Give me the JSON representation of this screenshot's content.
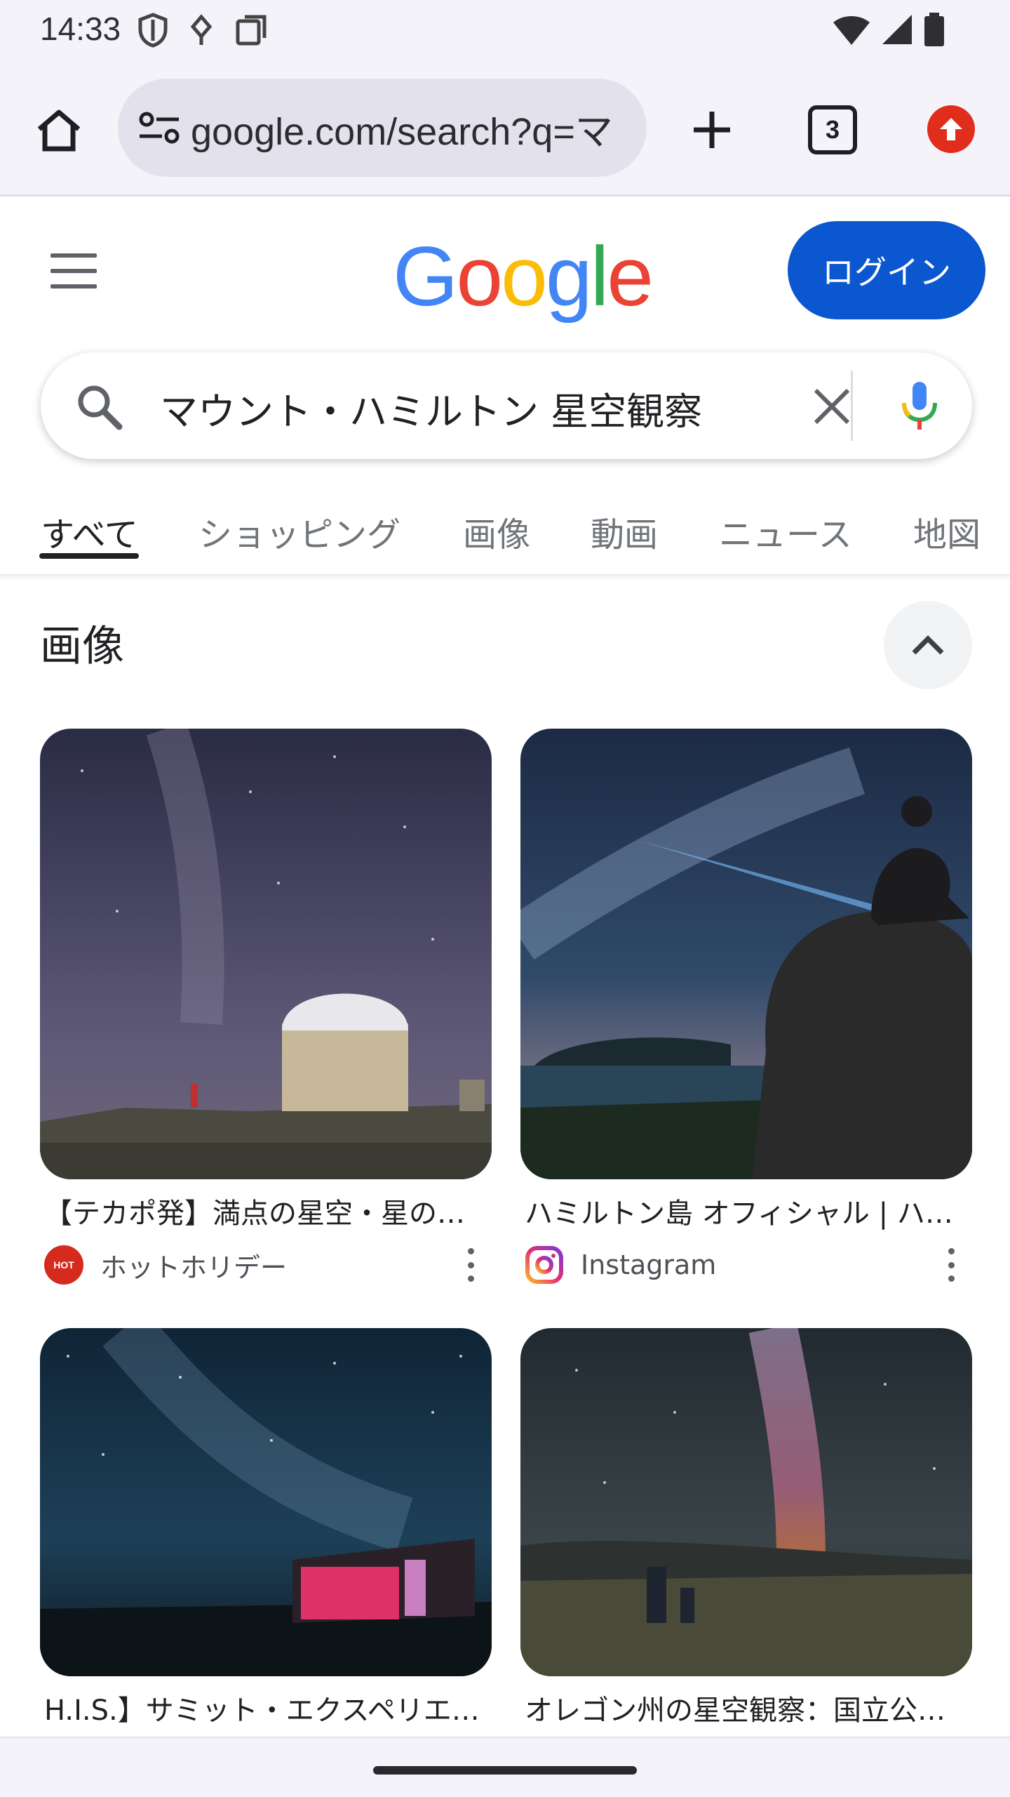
{
  "status_bar": {
    "time": "14:33"
  },
  "browser": {
    "url": "google.com/search?q=マ",
    "tab_count": "3"
  },
  "header": {
    "logo": [
      "G",
      "o",
      "o",
      "g",
      "l",
      "e"
    ],
    "login_label": "ログイン"
  },
  "search": {
    "query": "マウント・ハミルトン 星空観察"
  },
  "tabs": [
    {
      "label": "すべて",
      "active": true
    },
    {
      "label": "ショッピング",
      "active": false
    },
    {
      "label": "画像",
      "active": false
    },
    {
      "label": "動画",
      "active": false
    },
    {
      "label": "ニュース",
      "active": false
    },
    {
      "label": "地図",
      "active": false
    }
  ],
  "images_section": {
    "title": "画像",
    "results": [
      {
        "title": "【テカポ発】満点の星空・星の…",
        "source": "ホットホリデー",
        "source_icon_text": "HOT"
      },
      {
        "title": "ハミルトン島 オフィシャル | ハ…",
        "source": "Instagram"
      },
      {
        "title": "H.I.S.】サミット・エクスペリエ…",
        "source": ""
      },
      {
        "title": "オレゴン州の星空観察：国立公…",
        "source": ""
      }
    ]
  },
  "colors": {
    "accent": "#0b57d0",
    "google_blue": "#4285f4",
    "google_red": "#ea4335",
    "google_yellow": "#fbbc05",
    "google_green": "#34a853"
  }
}
